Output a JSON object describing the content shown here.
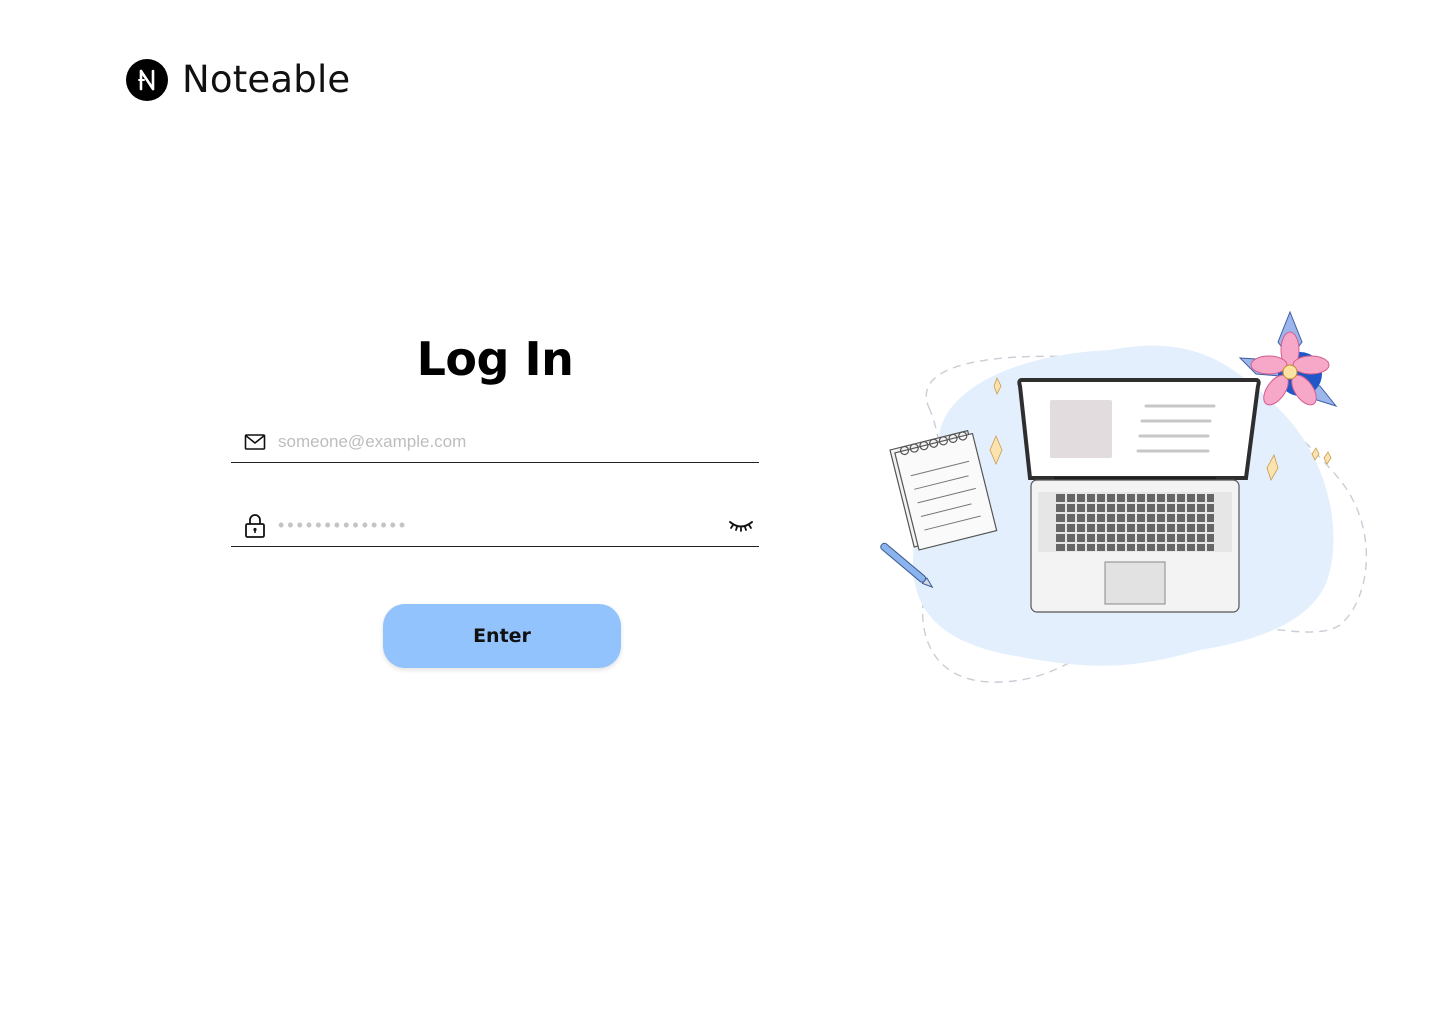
{
  "brand": {
    "name": "Noteable",
    "logo_letter": "N"
  },
  "login": {
    "title": "Log In",
    "email_placeholder": "someone@example.com",
    "password_placeholder": "••••••••••••••",
    "submit_label": "Enter"
  },
  "icons": {
    "email": "envelope-icon",
    "password": "lock-icon",
    "toggle": "eye-closed-icon"
  },
  "colors": {
    "accent": "#93c3fc",
    "illustration_blob": "#e3effd",
    "text": "#000000"
  }
}
